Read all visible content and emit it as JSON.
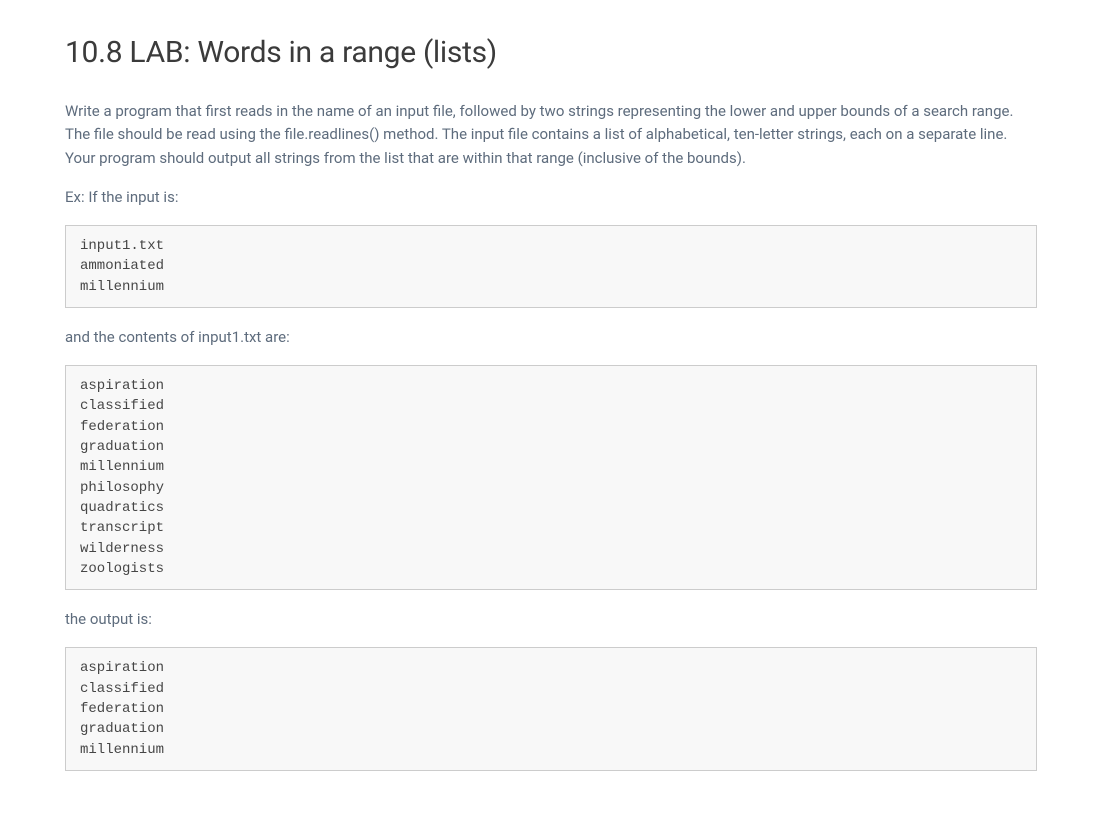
{
  "title": "10.8 LAB: Words in a range (lists)",
  "intro": "Write a program that first reads in the name of an input file, followed by two strings representing the lower and upper bounds of a search range. The file should be read using the file.readlines() method. The input file contains a list of alphabetical, ten-letter strings, each on a separate line. Your program should output all strings from the list that are within that range (inclusive of the bounds).",
  "ex_label": "Ex: If the input is:",
  "input_block": "input1.txt\nammoniated\nmillennium",
  "contents_label": "and the contents of input1.txt are:",
  "contents_block": "aspiration\nclassified\nfederation\ngraduation\nmillennium\nphilosophy\nquadratics\ntranscript\nwilderness\nzoologists",
  "output_label": "the output is:",
  "output_block": "aspiration\nclassified\nfederation\ngraduation\nmillennium"
}
